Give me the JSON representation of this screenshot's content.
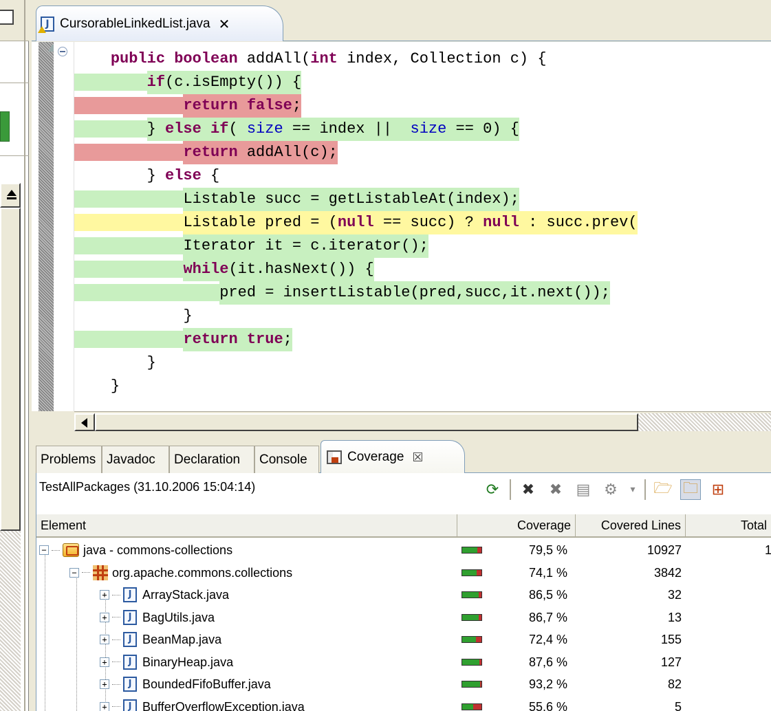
{
  "editor": {
    "tab_title": "CursorableLinkedList.java",
    "close_glyph": "✕"
  },
  "code_lines": [
    {
      "indent": "    ",
      "parts": [
        {
          "t": "public",
          "k": 1
        },
        {
          "t": " "
        },
        {
          "t": "boolean",
          "k": 1
        },
        {
          "t": " addAll("
        },
        {
          "t": "int",
          "k": 1
        },
        {
          "t": " index, Collection c) {"
        }
      ],
      "cov": "none"
    },
    {
      "indent": "        ",
      "parts": [
        {
          "t": "if",
          "k": 1
        },
        {
          "t": "(c.isEmpty()) {"
        }
      ],
      "cov": "green"
    },
    {
      "indent": "            ",
      "parts": [
        {
          "t": "return",
          "k": 1
        },
        {
          "t": " "
        },
        {
          "t": "false",
          "k": 1
        },
        {
          "t": ";"
        }
      ],
      "cov": "red"
    },
    {
      "indent": "        ",
      "parts": [
        {
          "t": "} "
        },
        {
          "t": "else",
          "k": 1
        },
        {
          "t": " "
        },
        {
          "t": "if",
          "k": 1
        },
        {
          "t": "( "
        },
        {
          "t": "size",
          "f": 1
        },
        {
          "t": " == index ||  "
        },
        {
          "t": "size",
          "f": 1
        },
        {
          "t": " == 0) {"
        }
      ],
      "cov": "green"
    },
    {
      "indent": "            ",
      "parts": [
        {
          "t": "return",
          "k": 1
        },
        {
          "t": " addAll(c);"
        }
      ],
      "cov": "red"
    },
    {
      "indent": "        ",
      "parts": [
        {
          "t": "} "
        },
        {
          "t": "else",
          "k": 1
        },
        {
          "t": " {"
        }
      ],
      "cov": "none"
    },
    {
      "indent": "            ",
      "parts": [
        {
          "t": "Listable succ = getListableAt(index);"
        }
      ],
      "cov": "green"
    },
    {
      "indent": "            ",
      "parts": [
        {
          "t": "Listable pred = ("
        },
        {
          "t": "null",
          "k": 1
        },
        {
          "t": " == succ) ? "
        },
        {
          "t": "null",
          "k": 1
        },
        {
          "t": " : succ.prev("
        }
      ],
      "cov": "yellow"
    },
    {
      "indent": "            ",
      "parts": [
        {
          "t": "Iterator it = c.iterator();"
        }
      ],
      "cov": "green"
    },
    {
      "indent": "            ",
      "parts": [
        {
          "t": "while",
          "k": 1
        },
        {
          "t": "(it.hasNext()) {"
        }
      ],
      "cov": "green"
    },
    {
      "indent": "                ",
      "parts": [
        {
          "t": "pred = insertListable(pred,succ,it.next());"
        }
      ],
      "cov": "green"
    },
    {
      "indent": "            ",
      "parts": [
        {
          "t": "}"
        }
      ],
      "cov": "none"
    },
    {
      "indent": "            ",
      "parts": [
        {
          "t": "return",
          "k": 1
        },
        {
          "t": " "
        },
        {
          "t": "true",
          "k": 1
        },
        {
          "t": ";"
        }
      ],
      "cov": "green"
    },
    {
      "indent": "        ",
      "parts": [
        {
          "t": "}"
        }
      ],
      "cov": "none"
    },
    {
      "indent": "    ",
      "parts": [
        {
          "t": "}"
        }
      ],
      "cov": "none"
    }
  ],
  "panel": {
    "tabs": [
      "Problems",
      "Javadoc",
      "Declaration",
      "Console",
      "Coverage"
    ],
    "active_tab_close": "☒",
    "session_label": "TestAllPackages (31.10.2006 15:04:14)",
    "toolbar_icons": [
      "relaunch-icon",
      "remove-session-icon",
      "remove-all-sessions-icon",
      "merge-sessions-icon",
      "select-session-icon",
      "dropdown-icon",
      "show-projects-icon",
      "show-package-roots-icon",
      "show-packages-icon"
    ],
    "columns": {
      "element": "Element",
      "coverage": "Coverage",
      "covered_lines": "Covered Lines",
      "total": "Total"
    }
  },
  "coverage_rows": [
    {
      "level": 0,
      "kind": "root",
      "name": "java - commons-collections",
      "coverage": "79,5 %",
      "pct": 0.795,
      "covered": "10927",
      "total": "1"
    },
    {
      "level": 1,
      "kind": "package",
      "name": "org.apache.commons.collections",
      "coverage": "74,1 %",
      "pct": 0.741,
      "covered": "3842",
      "total": ""
    },
    {
      "level": 2,
      "kind": "class",
      "name": "ArrayStack.java",
      "coverage": "86,5 %",
      "pct": 0.865,
      "covered": "32",
      "total": ""
    },
    {
      "level": 2,
      "kind": "class",
      "name": "BagUtils.java",
      "coverage": "86,7 %",
      "pct": 0.867,
      "covered": "13",
      "total": ""
    },
    {
      "level": 2,
      "kind": "class",
      "name": "BeanMap.java",
      "coverage": "72,4 %",
      "pct": 0.724,
      "covered": "155",
      "total": ""
    },
    {
      "level": 2,
      "kind": "class",
      "name": "BinaryHeap.java",
      "coverage": "87,6 %",
      "pct": 0.876,
      "covered": "127",
      "total": ""
    },
    {
      "level": 2,
      "kind": "class",
      "name": "BoundedFifoBuffer.java",
      "coverage": "93,2 %",
      "pct": 0.932,
      "covered": "82",
      "total": ""
    },
    {
      "level": 2,
      "kind": "class",
      "name": "BufferOverflowException.java",
      "coverage": "55,6 %",
      "pct": 0.556,
      "covered": "5",
      "total": ""
    }
  ]
}
